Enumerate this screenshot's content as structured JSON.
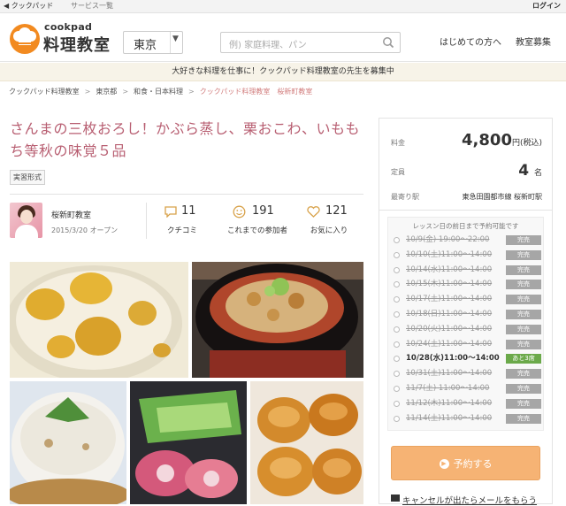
{
  "topbar": {
    "back_label": "◀ クックパッド",
    "services_label": "サービス一覧",
    "login_label": "ログイン"
  },
  "header": {
    "logo_top": "cookpad",
    "logo_main": "料理教室",
    "region_value": "東京",
    "search_placeholder": "例) 家庭料理、パン",
    "nav_first": "はじめての方へ",
    "nav_recruit": "教室募集"
  },
  "banner": {
    "text": "大好きな料理を仕事に！クックパッド料理教室の先生を募集中"
  },
  "breadcrumb": [
    "クックパッド料理教室",
    "東京都",
    "和食・日本料理",
    "クックパッド料理教室　桜新町教室"
  ],
  "lesson": {
    "title": "さんまの三枚おろし！かぶら蒸し、栗おこわ、いももち等秋の味覚５品",
    "tag": "実習形式",
    "school_name": "桜新町教室",
    "open_date": "2015/3/20 オープン"
  },
  "stats": [
    {
      "num": "11",
      "label": "クチコミ",
      "icon": "comment-icon"
    },
    {
      "num": "191",
      "label": "これまでの参加者",
      "icon": "smiley-icon"
    },
    {
      "num": "121",
      "label": "お気に入り",
      "icon": "heart-icon"
    }
  ],
  "sidebar": {
    "price_label": "料金",
    "price_value": "4,800",
    "price_unit": "円(税込)",
    "capacity_label": "定員",
    "capacity_value": "4",
    "capacity_unit": "名",
    "station_label": "最寄り駅",
    "station_value": "東急田園都市線 桜新町駅",
    "schedule_note": "レッスン日の前日まで予約可能です",
    "schedule": [
      {
        "date": "10/9(金) 19:00〜22:00",
        "status": "完売",
        "open": false
      },
      {
        "date": "10/10(土)11:00〜14:00",
        "status": "完売",
        "open": false
      },
      {
        "date": "10/14(水)11:00〜14:00",
        "status": "完売",
        "open": false
      },
      {
        "date": "10/15(木)11:00〜14:00",
        "status": "完売",
        "open": false
      },
      {
        "date": "10/17(土)11:00〜14:00",
        "status": "完売",
        "open": false
      },
      {
        "date": "10/18(日)11:00〜14:00",
        "status": "完売",
        "open": false
      },
      {
        "date": "10/20(火)11:00〜14:00",
        "status": "完売",
        "open": false
      },
      {
        "date": "10/24(土)11:00〜14:00",
        "status": "完売",
        "open": false
      },
      {
        "date": "10/28(水)11:00〜14:00",
        "status": "あと3席",
        "open": true
      },
      {
        "date": "10/31(土)11:00〜14:00",
        "status": "完売",
        "open": false
      },
      {
        "date": "11/7(土) 11:00〜14:00",
        "status": "完売",
        "open": false
      },
      {
        "date": "11/12(木)11:00〜14:00",
        "status": "完売",
        "open": false
      },
      {
        "date": "11/14(土)11:00〜14:00",
        "status": "完売",
        "open": false
      }
    ],
    "reserve_label": "予約する",
    "cancel_link": "キャンセルが出たらメールをもらう"
  },
  "colors": {
    "title": "#b85f72",
    "reserve": "#f6b374",
    "open_badge": "#6ba94a",
    "soldout_badge": "#a6a6a6",
    "banner_bg": "#f7f3e8"
  }
}
